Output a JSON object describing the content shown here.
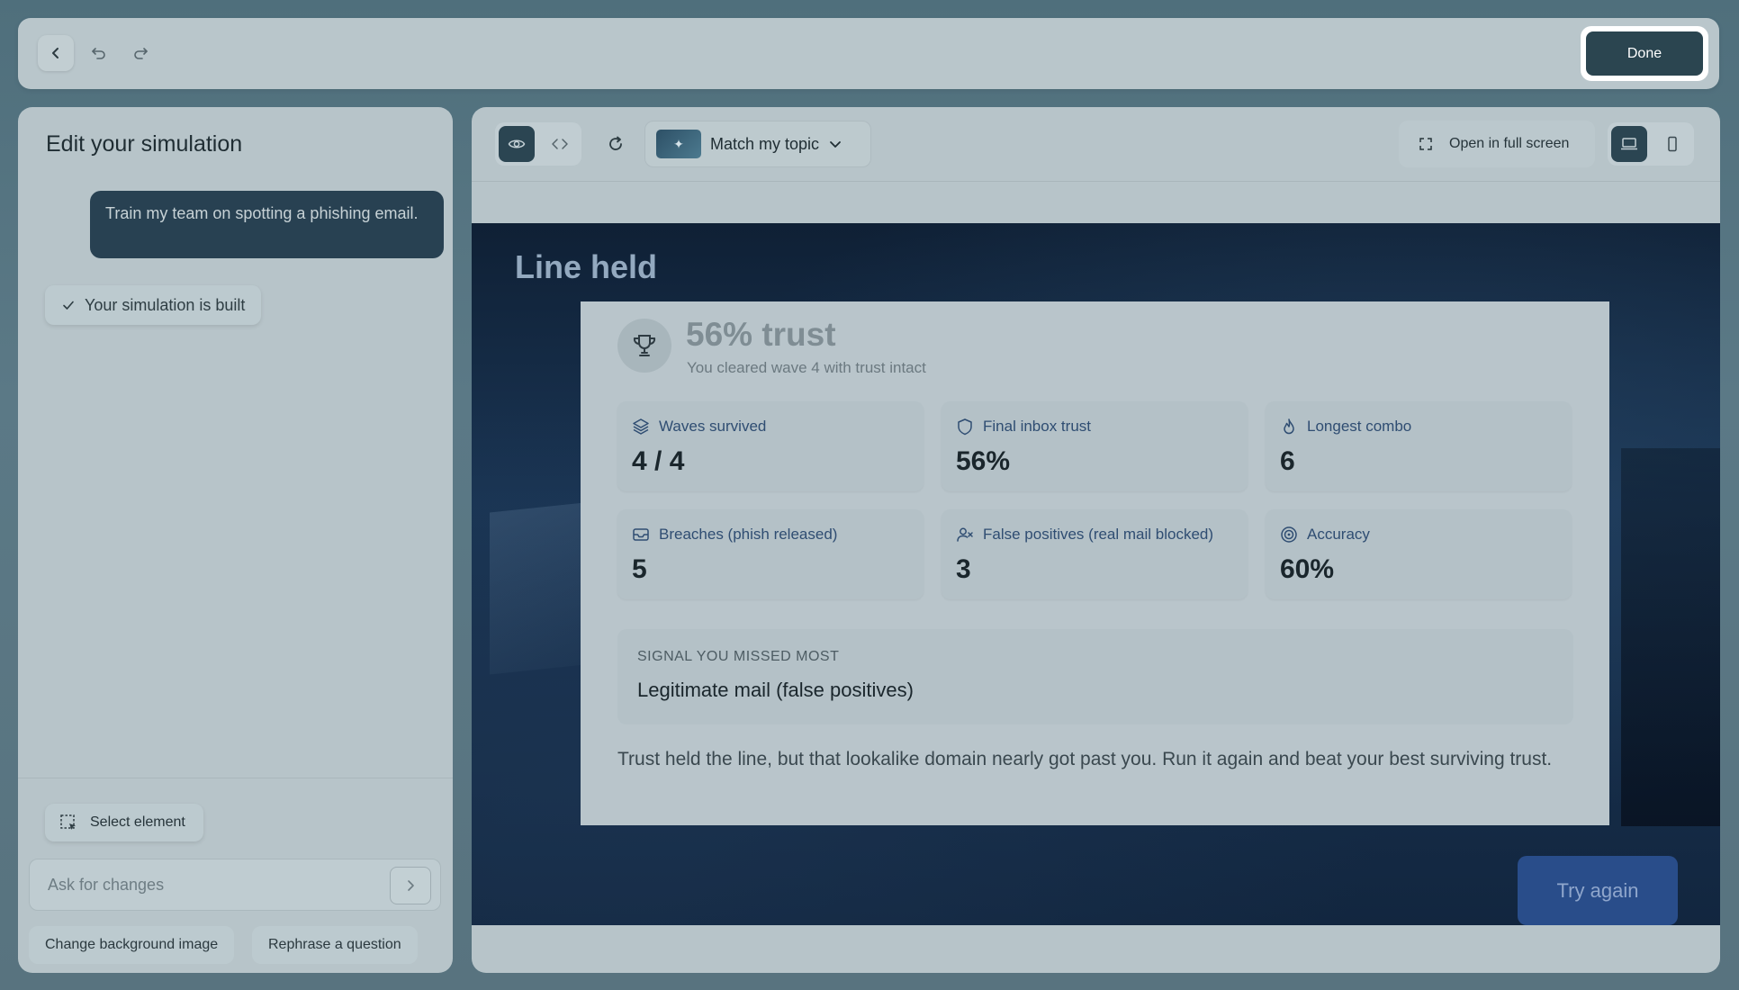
{
  "topbar": {
    "done_label": "Done"
  },
  "left_panel": {
    "title": "Edit your simulation",
    "user_message": "Train my team on spotting a phishing email.",
    "status": "Your simulation is built",
    "select_element_label": "Select element",
    "ask_placeholder": "Ask for changes",
    "suggestions": [
      "Change background image",
      "Rephrase a question"
    ]
  },
  "toolbar": {
    "topic_label": "Match my topic",
    "fullscreen_label": "Open in full screen"
  },
  "preview": {
    "title": "Line held",
    "trust_title": "56% trust",
    "trust_subtitle": "You cleared wave 4 with trust intact",
    "stats": [
      {
        "label": "Waves survived",
        "value": "4 / 4",
        "icon": "layers-icon"
      },
      {
        "label": "Final inbox trust",
        "value": "56%",
        "icon": "shield-icon"
      },
      {
        "label": "Longest combo",
        "value": "6",
        "icon": "flame-icon"
      },
      {
        "label": "Breaches (phish released)",
        "value": "5",
        "icon": "inbox-icon"
      },
      {
        "label": "False positives (real mail blocked)",
        "value": "3",
        "icon": "user-x-icon"
      },
      {
        "label": "Accuracy",
        "value": "60%",
        "icon": "target-icon"
      }
    ],
    "missed_label": "SIGNAL YOU MISSED MOST",
    "missed_value": "Legitimate mail (false positives)",
    "feedback": "Trust held the line, but that lookalike domain nearly got past you. Run it again and beat your best surviving trust.",
    "try_again_label": "Try again"
  },
  "colors": {
    "primary_dark": "#2b4552",
    "accent_blue": "#294d8a",
    "label_blue": "#2f4d72"
  }
}
